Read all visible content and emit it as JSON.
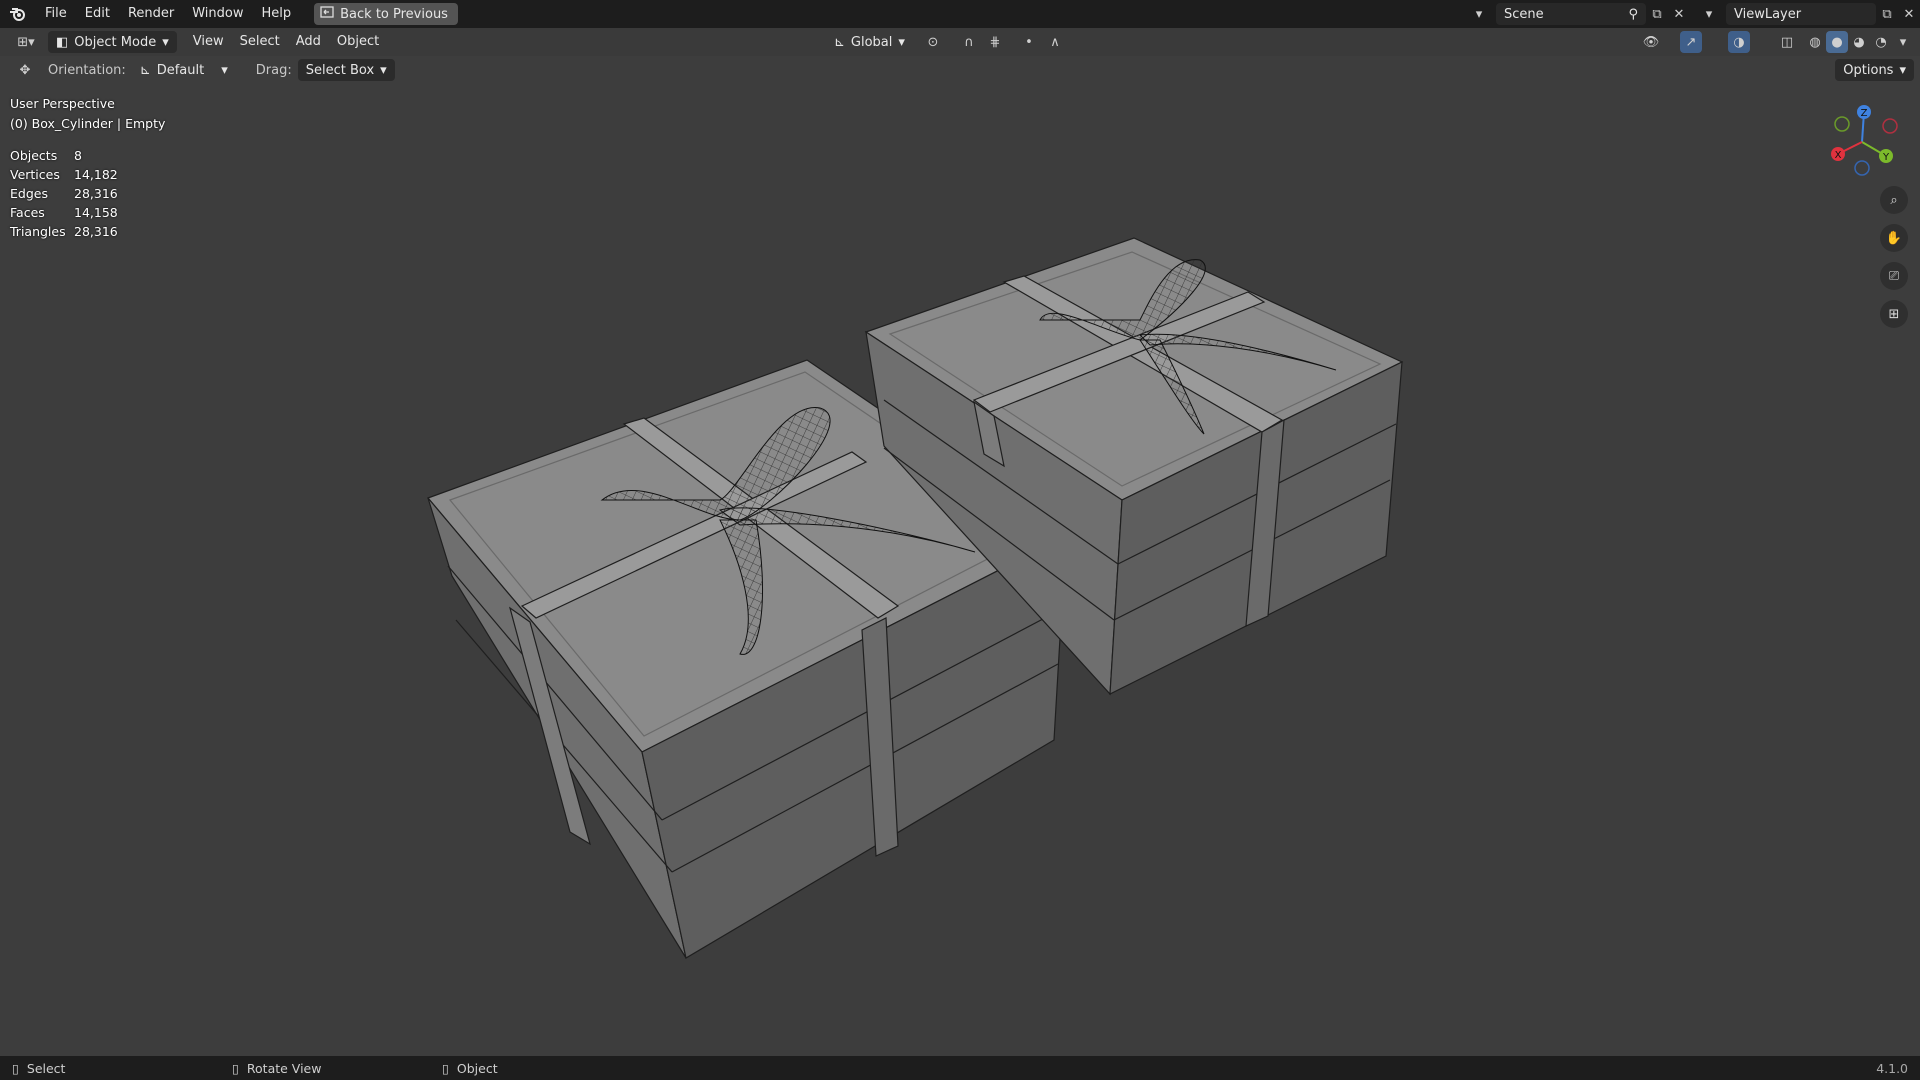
{
  "menu": {
    "items": [
      "File",
      "Edit",
      "Render",
      "Window",
      "Help"
    ],
    "back_button": "Back to Previous"
  },
  "topright": {
    "scene": "Scene",
    "viewlayer": "ViewLayer"
  },
  "header": {
    "mode": "Object Mode",
    "view": "View",
    "select": "Select",
    "add": "Add",
    "object": "Object",
    "transform_space": "Global"
  },
  "tool_header": {
    "orientation_label": "Orientation:",
    "orientation_value": "Default",
    "drag_label": "Drag:",
    "drag_value": "Select Box",
    "options": "Options"
  },
  "viewport": {
    "perspective": "User Perspective",
    "active": "(0) Box_Cylinder | Empty"
  },
  "stats": [
    {
      "label": "Objects",
      "value": "8"
    },
    {
      "label": "Vertices",
      "value": "14,182"
    },
    {
      "label": "Edges",
      "value": "28,316"
    },
    {
      "label": "Faces",
      "value": "14,158"
    },
    {
      "label": "Triangles",
      "value": "28,316"
    }
  ],
  "gizmo": {
    "x": "X",
    "y": "Y",
    "z": "Z"
  },
  "status": {
    "select": "Select",
    "rotate": "Rotate View",
    "object": "Object",
    "version": "4.1.0"
  }
}
